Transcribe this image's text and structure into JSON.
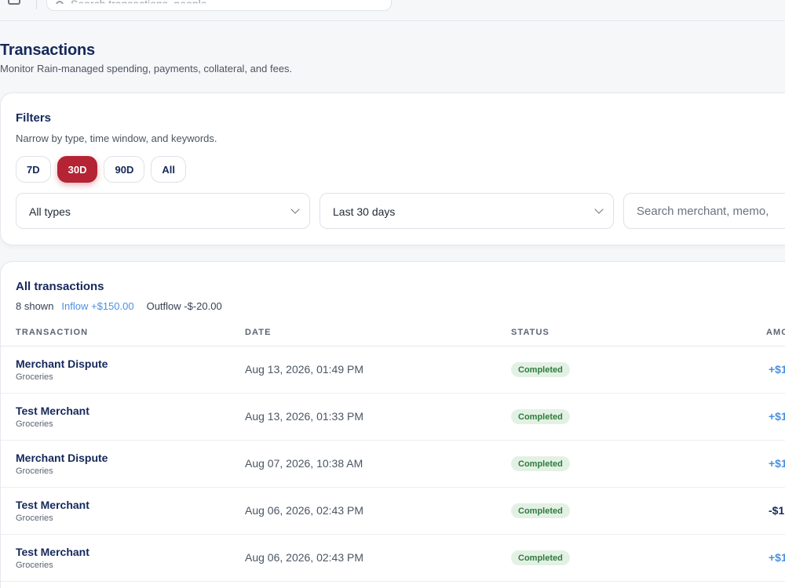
{
  "header": {
    "search_placeholder": "Search transactions, people"
  },
  "page": {
    "title": "Transactions",
    "subtitle": "Monitor Rain-managed spending, payments, collateral, and fees."
  },
  "filters": {
    "title": "Filters",
    "subtitle": "Narrow by type, time window, and keywords.",
    "ranges": [
      "7D",
      "30D",
      "90D",
      "All"
    ],
    "active_range": "30D",
    "type_select": "All types",
    "window_select": "Last 30 days",
    "search_placeholder": "Search merchant, memo,"
  },
  "transactions": {
    "title": "All transactions",
    "shown": "8 shown",
    "inflow": "Inflow +$150.00",
    "outflow": "Outflow -$-20.00",
    "columns": [
      "TRANSACTION",
      "DATE",
      "STATUS",
      "AMO"
    ],
    "rows": [
      {
        "name": "Merchant Dispute",
        "category": "Groceries",
        "date": "Aug 13, 2026, 01:49 PM",
        "status": "Completed",
        "amount": "+$1"
      },
      {
        "name": "Test Merchant",
        "category": "Groceries",
        "date": "Aug 13, 2026, 01:33 PM",
        "status": "Completed",
        "amount": "+$1"
      },
      {
        "name": "Merchant Dispute",
        "category": "Groceries",
        "date": "Aug 07, 2026, 10:38 AM",
        "status": "Completed",
        "amount": "+$1"
      },
      {
        "name": "Test Merchant",
        "category": "Groceries",
        "date": "Aug 06, 2026, 02:43 PM",
        "status": "Completed",
        "amount": "-$1"
      },
      {
        "name": "Test Merchant",
        "category": "Groceries",
        "date": "Aug 06, 2026, 02:43 PM",
        "status": "Completed",
        "amount": "+$1"
      }
    ]
  },
  "colors": {
    "accent": "#b42434",
    "inflow": "#4a90e2",
    "status_completed_bg": "#e3f1e5",
    "status_completed_text": "#2f7a3b",
    "heading": "#14285a"
  }
}
